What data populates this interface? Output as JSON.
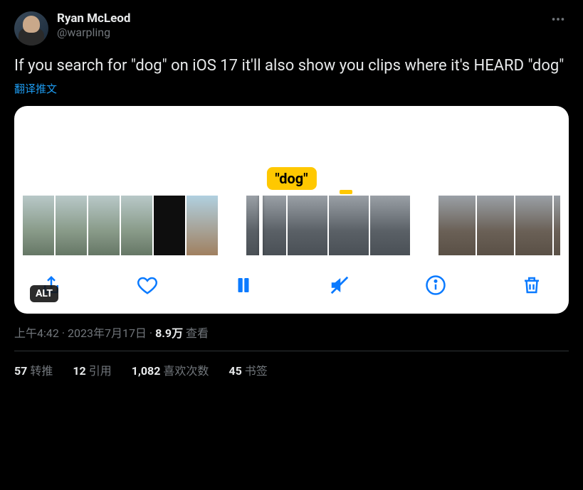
{
  "author": {
    "display_name": "Ryan McLeod",
    "handle": "@warpling"
  },
  "body_text": "If you search for \"dog\" on iOS 17 it'll also show you clips where it's HEARD \"dog\"",
  "translate_label": "翻译推文",
  "media": {
    "tooltip_label": "\"dog\"",
    "alt_badge": "ALT",
    "toolbar": {
      "share": "share-icon",
      "like": "heart-icon",
      "pause": "pause-icon",
      "mute": "mute-icon",
      "info": "info-icon",
      "delete": "trash-icon"
    }
  },
  "meta": {
    "time": "上午4:42",
    "dot": " · ",
    "date": "2023年7月17日",
    "views_number": "8.9万",
    "views_label": " 查看"
  },
  "stats": {
    "retweets_count": "57",
    "retweets_label": "转推",
    "quotes_count": "12",
    "quotes_label": "引用",
    "likes_count": "1,082",
    "likes_label": "喜欢次数",
    "bookmarks_count": "45",
    "bookmarks_label": "书签"
  }
}
